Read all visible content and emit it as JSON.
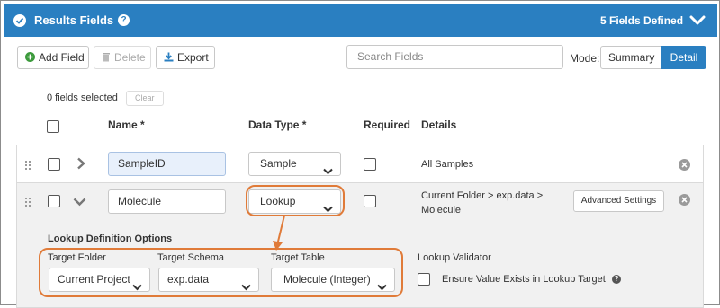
{
  "header": {
    "title": "Results Fields",
    "help_glyph": "?",
    "fields_count": "5 Fields Defined"
  },
  "toolbar": {
    "add_field": "Add Field",
    "delete": "Delete",
    "export": "Export",
    "search_placeholder": "Search Fields",
    "mode_label": "Mode:",
    "mode_summary": "Summary",
    "mode_detail": "Detail",
    "active_mode": "Detail"
  },
  "selection": {
    "selected_text": "0 fields selected",
    "clear": "Clear"
  },
  "columns": {
    "name": "Name *",
    "data_type": "Data Type *",
    "required": "Required",
    "details": "Details"
  },
  "rows": [
    {
      "name": "SampleID",
      "data_type": "Sample",
      "required": false,
      "details": "All Samples",
      "expanded": false
    },
    {
      "name": "Molecule",
      "data_type": "Lookup",
      "required": false,
      "details_line1": "Current Folder > exp.data >",
      "details_line2": "Molecule",
      "advanced_settings": "Advanced Settings",
      "expanded": true
    }
  ],
  "lookup": {
    "section_title": "Lookup Definition Options",
    "target_folder_label": "Target Folder",
    "target_folder_value": "Current Project",
    "target_schema_label": "Target Schema",
    "target_schema_value": "exp.data",
    "target_table_label": "Target Table",
    "target_table_value": "Molecule (Integer)",
    "validator_label": "Lookup Validator",
    "validator_option": "Ensure Value Exists in Lookup Target",
    "validator_checked": false,
    "help_glyph": "?"
  },
  "colors": {
    "header_bg": "#2a7fc1",
    "active_mode_bg": "#2a7fc1",
    "callout": "#e07b39",
    "add_icon": "#3c9a3c",
    "export_icon": "#2a7fc1"
  },
  "icons": {
    "header_check": "check-circle-icon",
    "header_help": "question-circle-icon",
    "collapse": "chevron-down-icon",
    "add": "plus-circle-icon",
    "delete": "trash-icon",
    "export": "download-icon",
    "drag": "drag-handle-icon",
    "row_collapsed": "chevron-right-icon",
    "row_expanded": "chevron-down-icon",
    "remove": "times-circle-icon",
    "select_caret": "caret-down-icon"
  }
}
